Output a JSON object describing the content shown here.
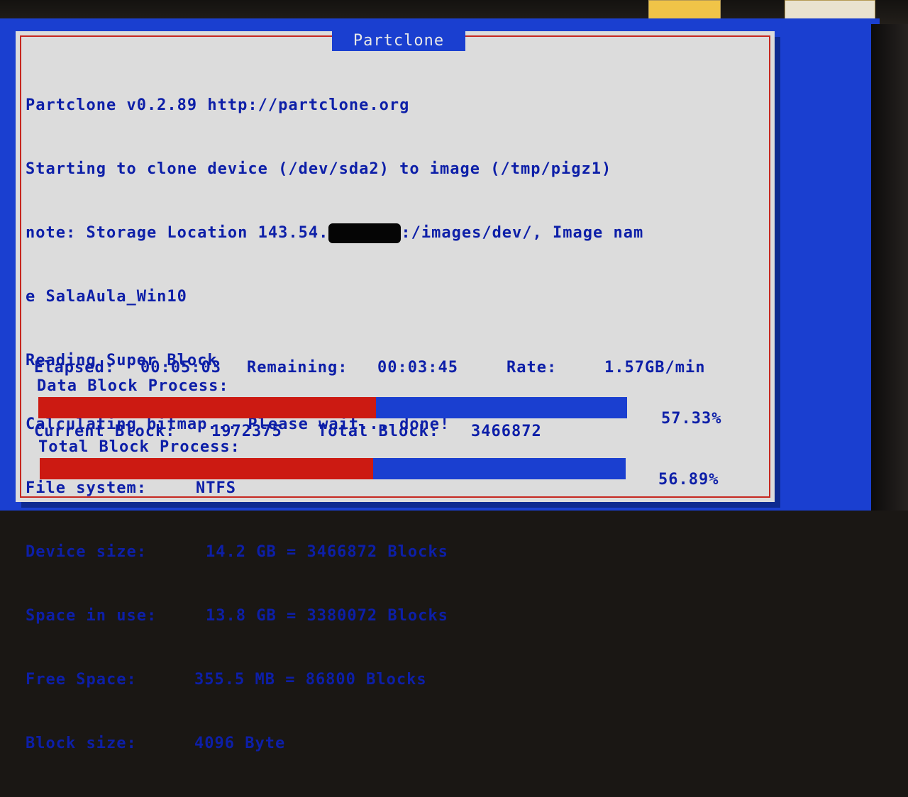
{
  "window": {
    "title": "Partclone"
  },
  "log": {
    "line1": "Partclone v0.2.89 http://partclone.org",
    "line2": "Starting to clone device (/dev/sda2) to image (/tmp/pigz1)",
    "line3_prefix": "note: Storage Location 143.54.",
    "line3_suffix": ":/images/dev/, Image nam",
    "line4": "e SalaAula_Win10",
    "line5": "Reading Super Block",
    "line6": "Calculating bitmap... Please wait... done!"
  },
  "info": {
    "fs_label": "File system:",
    "fs_value": "NTFS",
    "device_label": "Device size:",
    "device_value": "14.2 GB = 3466872 Blocks",
    "inuse_label": "Space in use:",
    "inuse_value": "13.8 GB = 3380072 Blocks",
    "free_label": "Free Space:",
    "free_value": "355.5 MB = 86800 Blocks",
    "block_label": "Block size:",
    "block_value": "4096 Byte"
  },
  "stats": {
    "elapsed_label": "Elapsed:",
    "elapsed_value": "00:05:03",
    "remaining_label": "Remaining:",
    "remaining_value": "00:03:45",
    "rate_label": "Rate:",
    "rate_value": "1.57GB/min",
    "current_label": "Current Block:",
    "current_value": "1972375",
    "total_label": "Total Block:",
    "total_value": "3466872"
  },
  "data_process": {
    "label": "Data Block Process:",
    "percent_text": "57.33%",
    "fraction": 0.5733
  },
  "total_process": {
    "label": "Total Block Process:",
    "percent_text": "56.89%",
    "fraction": 0.5689
  },
  "colors": {
    "screen_bg": "#1a3fd0",
    "dialog_bg": "#dcdcdc",
    "text": "#0d1fa8",
    "progress_fill": "#cc1a12"
  }
}
